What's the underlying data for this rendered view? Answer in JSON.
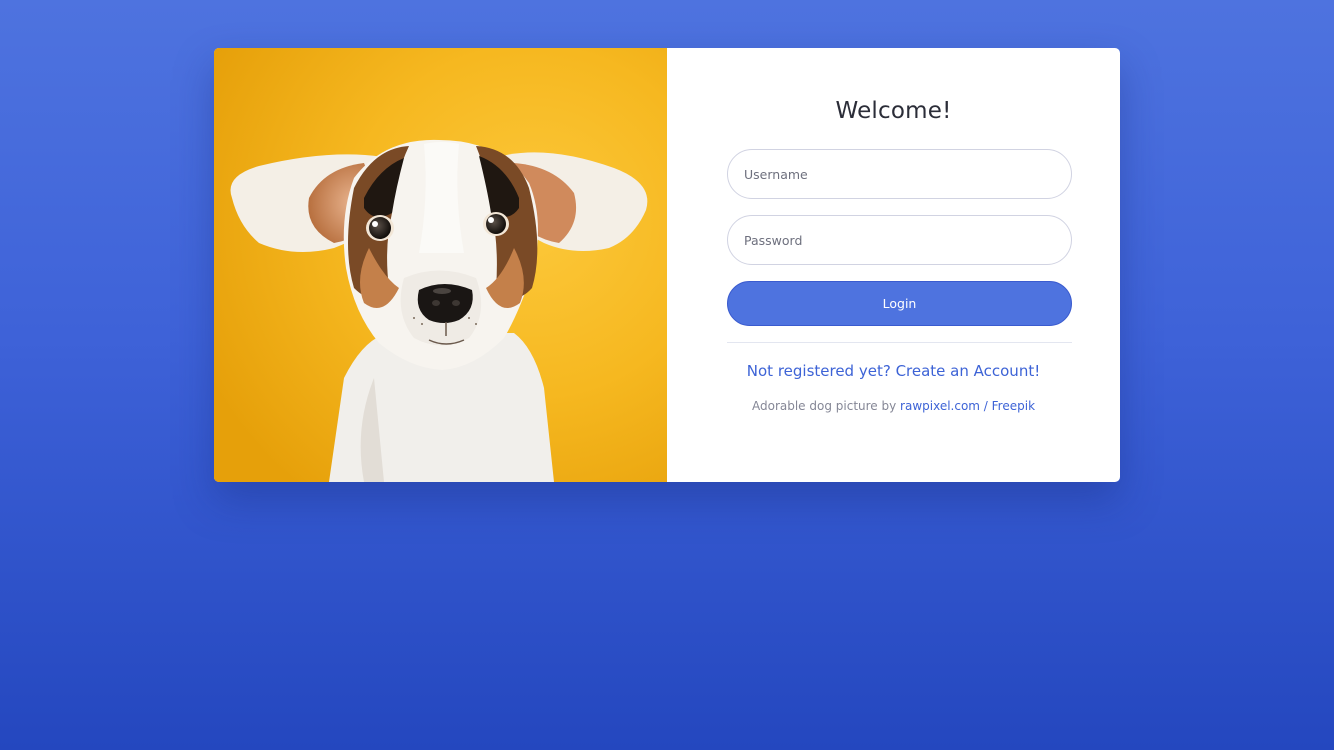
{
  "login": {
    "title": "Welcome!",
    "username_placeholder": "Username",
    "password_placeholder": "Password",
    "login_label": "Login",
    "register_link": "Not registered yet? Create an Account!",
    "credit_prefix": "Adorable dog picture by ",
    "credit_link": "rawpixel.com / Freepik"
  },
  "image": {
    "subject": "jack-russell-dog-photo",
    "background_color": "#f6b91f"
  },
  "colors": {
    "primary": "#4e73df",
    "link": "#3d63d6",
    "background_top": "#4e73df",
    "background_bottom": "#2447bf"
  }
}
